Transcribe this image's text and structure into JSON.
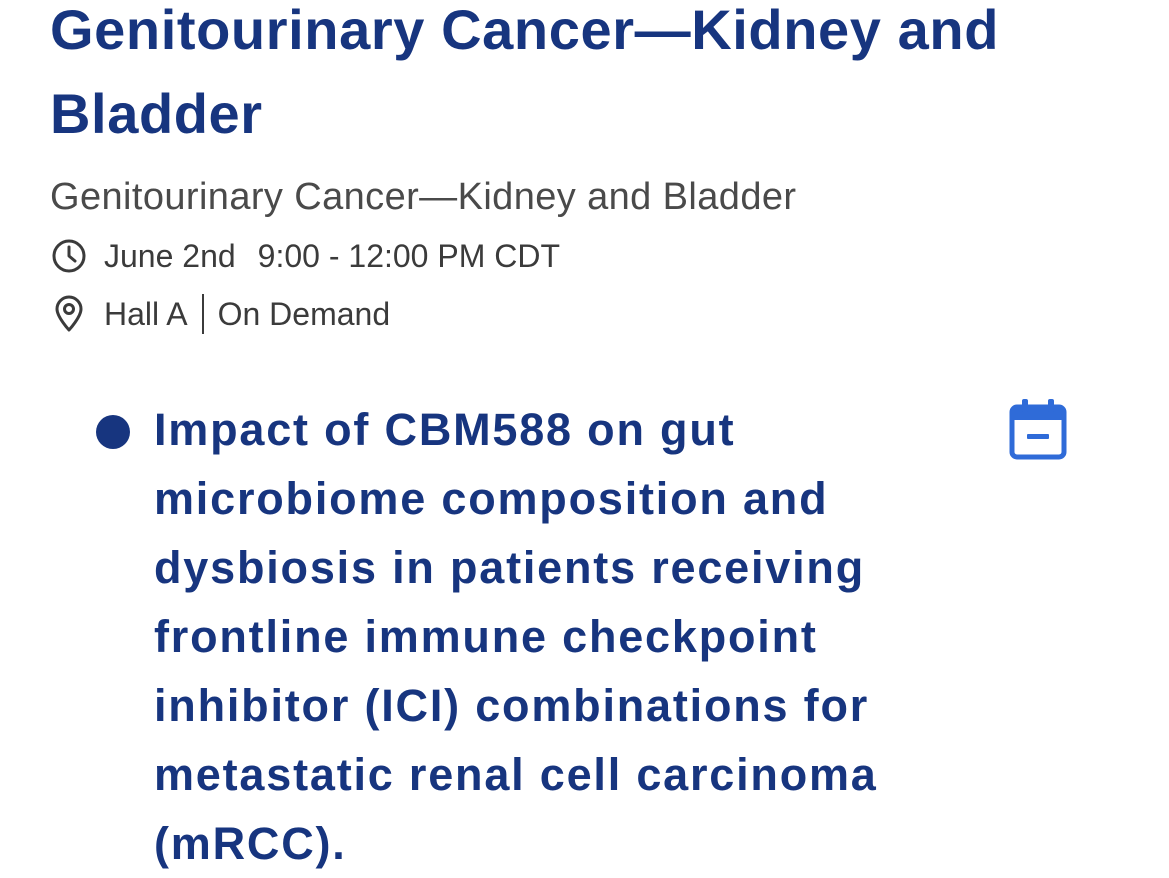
{
  "session": {
    "title": "Genitourinary Cancer—Kidney and Bladder",
    "subtitle": "Genitourinary Cancer—Kidney and Bladder",
    "date": "June 2nd",
    "time": "9:00 - 12:00 PM CDT",
    "room": "Hall A",
    "availability": "On Demand"
  },
  "talks": [
    {
      "title": "Impact of CBM588 on gut microbiome composition and dysbiosis in patients receiving frontline immune checkpoint inhibitor (ICI) combinations for metastatic renal cell carcinoma (mRCC)."
    }
  ],
  "icons": {
    "time": "clock-icon",
    "location": "map-pin-icon",
    "bullet": "bullet-dot",
    "calendar": "calendar-remove-icon"
  },
  "colors": {
    "title": "#17357f",
    "subtitle": "#4a4a4a",
    "meta_text": "#3b3b3b",
    "calendar_accent": "#2f6bd8",
    "background": "#ffffff"
  }
}
